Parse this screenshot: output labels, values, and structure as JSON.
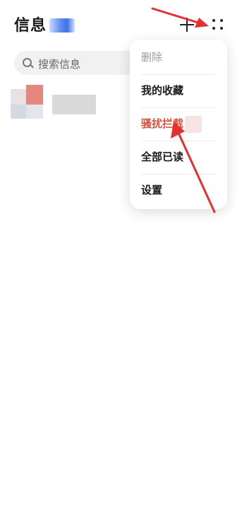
{
  "header": {
    "title": "信息",
    "add_icon": "plus-icon",
    "more_icon": "more-dots-icon"
  },
  "search": {
    "placeholder": "搜索信息",
    "icon": "search-icon"
  },
  "menu": {
    "items": [
      {
        "label": "删除",
        "state": "disabled"
      },
      {
        "label": "我的收藏"
      },
      {
        "label": "骚扰拦截",
        "state": "highlighted"
      },
      {
        "label": "全部已读"
      },
      {
        "label": "设置"
      }
    ]
  },
  "colors": {
    "accent": "#d9553f",
    "arrow": "#e5302f",
    "disabled": "#9b9b9b"
  }
}
